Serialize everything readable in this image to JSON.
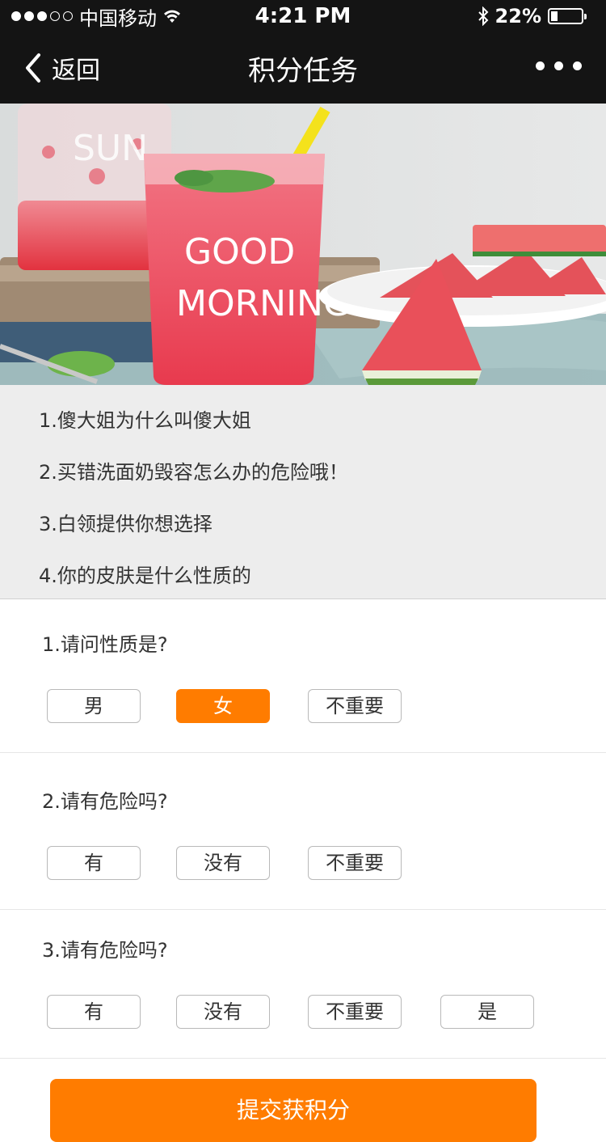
{
  "status_bar": {
    "carrier": "中国移动",
    "time": "4:21 PM",
    "battery_text": "22%",
    "battery_level": 0.22,
    "signal_bars": 3,
    "signal_total": 5,
    "icons": [
      "signal-icon",
      "wifi-icon",
      "bluetooth-icon",
      "battery-icon"
    ]
  },
  "nav": {
    "back_label": "返回",
    "title": "积分任务",
    "more_icon": "more-icon"
  },
  "banner": {
    "glass_text_line1": "GOOD",
    "glass_text_line2": "MORNING",
    "back_glass_text": "SUN"
  },
  "articles": [
    "1.傻大姐为什么叫傻大姐",
    "2.买错洗面奶毁容怎么办的危险哦！",
    "3.白领提供你想选择",
    "4.你的皮肤是什么性质的"
  ],
  "questions": [
    {
      "title": "1.请问性质是?",
      "options": [
        "男",
        "女",
        "不重要"
      ],
      "selected": 1
    },
    {
      "title": "2.请有危险吗?",
      "options": [
        "有",
        "没有",
        "不重要"
      ],
      "selected": null
    },
    {
      "title": "3.请有危险吗?",
      "options": [
        "有",
        "没有",
        "不重要",
        "是"
      ],
      "selected": null
    }
  ],
  "submit_label": "提交获积分",
  "colors": {
    "accent": "#ff7c00",
    "bar": "#141414",
    "list_bg": "#ededed"
  }
}
